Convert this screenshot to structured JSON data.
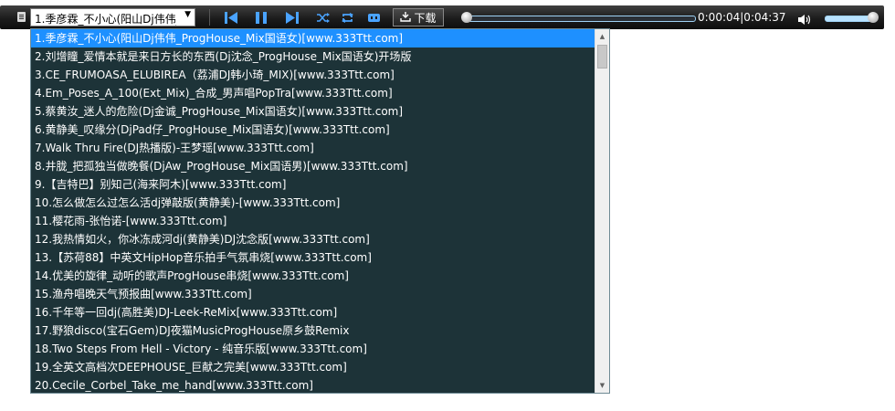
{
  "player": {
    "current_title": "1.季彦霖_不小心(阳山Dj伟伟_ProgHouse_Mix国语女)[www.333Ttt.com]",
    "dropdown_arrow": "▼",
    "icons": [
      "list-icon",
      "prev-icon",
      "pause-icon",
      "next-icon",
      "shuffle-icon",
      "repeat-icon",
      "lyrics-icon",
      "download-icon",
      "volume-icon"
    ],
    "download_label": "下载",
    "time": "0:00:04|0:04:37",
    "progress": 0.014,
    "volume": 0.9,
    "colors": {
      "accent": "#4aa3ff",
      "selected": "#1e90ff",
      "list_bg": "#1d3338"
    }
  },
  "playlist": {
    "items": [
      "1.季彦霖_不小心(阳山Dj伟伟_ProgHouse_Mix国语女)[www.333Ttt.com]",
      "2.刘增瞳_爱情本就是来日方长的东西(Dj沈念_ProgHouse_Mix国语女)开场版",
      "3.CE_FRUMOASA_ELUBIREA（荔浦DJ韩小琦_MIX)[www.333Ttt.com]",
      "4.Em_Poses_A_100(Ext_Mix)_合成_男声唱PopTra[www.333Ttt.com]",
      "5.蔡黄汝_迷人的危险(Dj金诚_ProgHouse_Mix国语女)[www.333Ttt.com]",
      "6.黄静美_叹缘分(DjPad仔_ProgHouse_Mix国语女)[www.333Ttt.com]",
      "7.Walk Thru Fire(DJ热播版)-王梦瑶[www.333Ttt.com]",
      "8.井胧_把孤独当做晚餐(DjAw_ProgHouse_Mix国语男)[www.333Ttt.com]",
      "9.【吉特巴】别知己(海来阿木)[www.333Ttt.com]",
      "10.怎么做怎么过怎么活dj弹敲版(黄静美)-[www.333Ttt.com]",
      "11.樱花雨-张怡诺-[www.333Ttt.com]",
      "12.我热情如火，你冰冻成河dj(黄静美)DJ沈念版[www.333Ttt.com]",
      "13.【苏荷88】中英文HipHop音乐拍手气氛串烧[www.333Ttt.com]",
      "14.优美的旋律_动听的歌声ProgHouse串烧[www.333Ttt.com]",
      "15.渔舟唱晚天气预报曲[www.333Ttt.com]",
      "16.千年等一回dj(高胜美)DJ-Leek-ReMix[www.333Ttt.com]",
      "17.野狼disco(宝石Gem)DJ夜猫MusicProgHouse原乡鼓Remix",
      "18.Two Steps From Hell - Victory - 纯音乐版[www.333Ttt.com]",
      "19.全英文高档次DEEPHOUSE_巨献之完美[www.333Ttt.com]",
      "20.Cecile_Corbel_Take_me_hand[www.333Ttt.com]"
    ],
    "selected_index": 0,
    "scroll_up": "▲",
    "scroll_down": "▼"
  }
}
